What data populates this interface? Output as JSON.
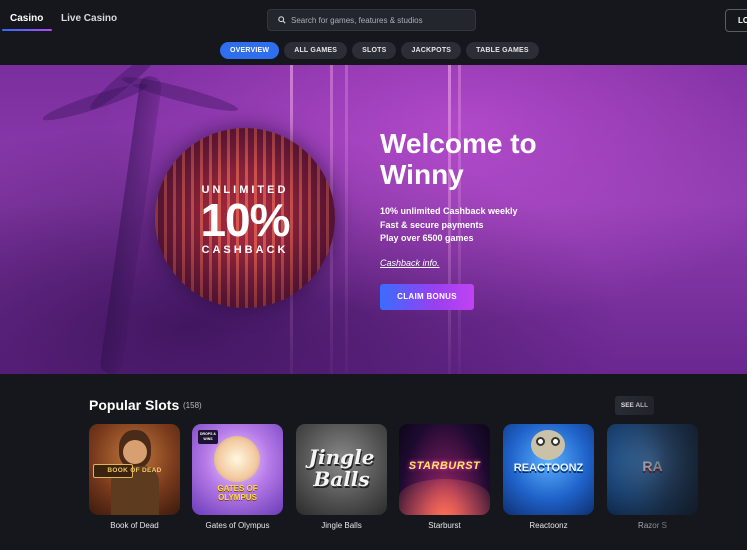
{
  "header": {
    "tabs": [
      {
        "label": "Casino",
        "active": true
      },
      {
        "label": "Live Casino",
        "active": false
      }
    ],
    "search": {
      "placeholder": "Search for games, features & studios",
      "value": ""
    },
    "login_label": "LO",
    "icons": {
      "search": "search-icon"
    }
  },
  "categories": [
    {
      "label": "OVERVIEW",
      "active": true
    },
    {
      "label": "ALL GAMES",
      "active": false
    },
    {
      "label": "SLOTS",
      "active": false
    },
    {
      "label": "JACKPOTS",
      "active": false
    },
    {
      "label": "TABLE GAMES",
      "active": false
    }
  ],
  "hero": {
    "promo": {
      "line1": "UNLIMITED",
      "big": "10%",
      "line3": "CASHBACK"
    },
    "title": "Welcome to Winny",
    "features": [
      "10% unlimited Cashback weekly",
      "Fast & secure payments",
      "Play over 6500 games"
    ],
    "link": "Cashback info.",
    "cta": "CLAIM BONUS"
  },
  "popular": {
    "title": "Popular Slots",
    "count": "(158)",
    "see_all": "SEE ALL",
    "games": [
      {
        "name": "Book of Dead",
        "thumb_text": "BOOK OF DEAD"
      },
      {
        "name": "Gates of Olympus",
        "thumb_text": "GATES OF OLYMPUS",
        "badge": "DROPS & WINS"
      },
      {
        "name": "Jingle Balls",
        "thumb_text": "Jingle Balls"
      },
      {
        "name": "Starburst",
        "thumb_text": "STARBURST"
      },
      {
        "name": "Reactoonz",
        "thumb_text": "REACTOONZ"
      },
      {
        "name": "Razor S",
        "thumb_text": "RA"
      }
    ]
  },
  "colors": {
    "background": "#15171c",
    "accent_blue": "#2f6fee",
    "hero_purple": "#8d3cae",
    "cta_gradient_start": "#3b6cff",
    "cta_gradient_end": "#c043f2"
  }
}
